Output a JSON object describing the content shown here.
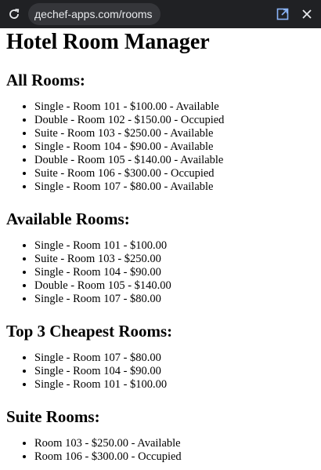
{
  "browser": {
    "url": "дechef-apps.com/rooms"
  },
  "page": {
    "title": "Hotel Room Manager",
    "sections": [
      {
        "heading": "All Rooms:",
        "items": [
          "Single - Room 101 - $100.00 - Available",
          "Double - Room 102 - $150.00 - Occupied",
          "Suite - Room 103 - $250.00 - Available",
          "Single - Room 104 - $90.00 - Available",
          "Double - Room 105 - $140.00 - Available",
          "Suite - Room 106 - $300.00 - Occupied",
          "Single - Room 107 - $80.00 - Available"
        ]
      },
      {
        "heading": "Available Rooms:",
        "items": [
          "Single - Room 101 - $100.00",
          "Suite - Room 103 - $250.00",
          "Single - Room 104 - $90.00",
          "Double - Room 105 - $140.00",
          "Single - Room 107 - $80.00"
        ]
      },
      {
        "heading": "Top 3 Cheapest Rooms:",
        "items": [
          "Single - Room 107 - $80.00",
          "Single - Room 104 - $90.00",
          "Single - Room 101 - $100.00"
        ]
      },
      {
        "heading": "Suite Rooms:",
        "items": [
          "Room 103 - $250.00 - Available",
          "Room 106 - $300.00 - Occupied"
        ]
      }
    ]
  }
}
